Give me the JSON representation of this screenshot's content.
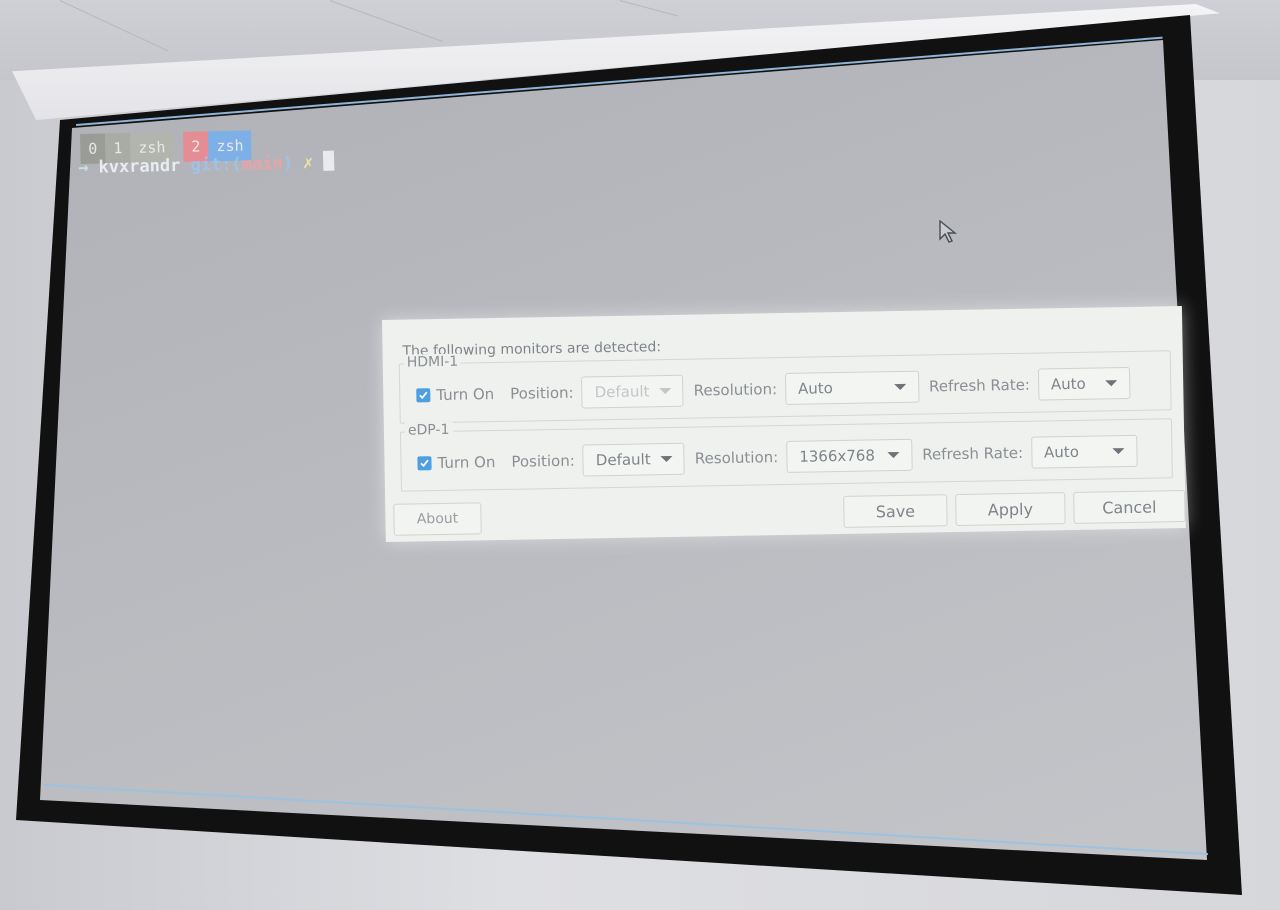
{
  "terminal": {
    "tmux_windows": [
      {
        "index": "0",
        "name": ""
      },
      {
        "index": "1",
        "name": "zsh"
      },
      {
        "index": "2",
        "name": "zsh"
      }
    ],
    "prompt": {
      "arrow": "→",
      "directory": "kvxrandr",
      "git_prefix": "git:(",
      "branch": "main",
      "git_suffix": ")",
      "dirty_marker": "✗"
    }
  },
  "dialog": {
    "title": "The following monitors are detected:",
    "monitors": [
      {
        "name": "HDMI-1",
        "turn_on_label": "Turn On",
        "turn_on_checked": true,
        "position_label": "Position:",
        "position_value": "Default",
        "position_enabled": false,
        "resolution_label": "Resolution:",
        "resolution_value": "Auto",
        "refresh_label": "Refresh Rate:",
        "refresh_value": "Auto"
      },
      {
        "name": "eDP-1",
        "turn_on_label": "Turn On",
        "turn_on_checked": true,
        "position_label": "Position:",
        "position_value": "Default",
        "position_enabled": true,
        "resolution_label": "Resolution:",
        "resolution_value": "1366x768",
        "refresh_label": "Refresh Rate:",
        "refresh_value": "Auto"
      }
    ],
    "buttons": {
      "about": "About",
      "save": "Save",
      "apply": "Apply",
      "cancel": "Cancel"
    }
  },
  "colors": {
    "checkbox_accent": "#4d9fe0",
    "tmux_active_name": "#7db0e6",
    "tmux_active_index": "#e58d94"
  },
  "icons": [
    "check-icon",
    "mouse-pointer-icon",
    "dropdown-caret-icon"
  ]
}
